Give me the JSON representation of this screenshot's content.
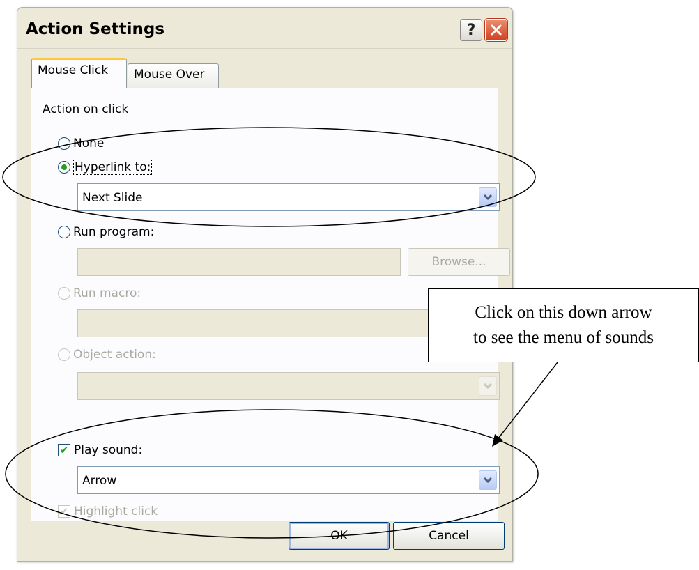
{
  "dialog": {
    "title": "Action Settings",
    "help_label": "?",
    "tabs": [
      {
        "label": "Mouse Click",
        "active": true
      },
      {
        "label": "Mouse Over",
        "active": false
      }
    ],
    "group_label": "Action on click",
    "options": {
      "none": {
        "label": "None",
        "checked": false
      },
      "hyperlink": {
        "label": "Hyperlink to:",
        "checked": true,
        "value": "Next Slide"
      },
      "run_program": {
        "label": "Run program:",
        "checked": false,
        "value": ""
      },
      "browse_label": "Browse...",
      "run_macro": {
        "label": "Run macro:",
        "enabled": false
      },
      "object_action": {
        "label": "Object action:",
        "enabled": false
      }
    },
    "play_sound": {
      "label": "Play sound:",
      "checked": true,
      "value": "Arrow"
    },
    "highlight_click": {
      "label": "Highlight click",
      "checked": true,
      "enabled": false
    },
    "ok_label": "OK",
    "cancel_label": "Cancel"
  },
  "callout": {
    "line1": "Click on this down arrow",
    "line2": "to see the menu of sounds"
  },
  "colors": {
    "dialog_bg": "#ece9d8",
    "panel_bg": "#fcfcfe",
    "active_tab_accent": "#ffc83c",
    "close_button": "#d0401f",
    "check_green": "#21a121"
  }
}
